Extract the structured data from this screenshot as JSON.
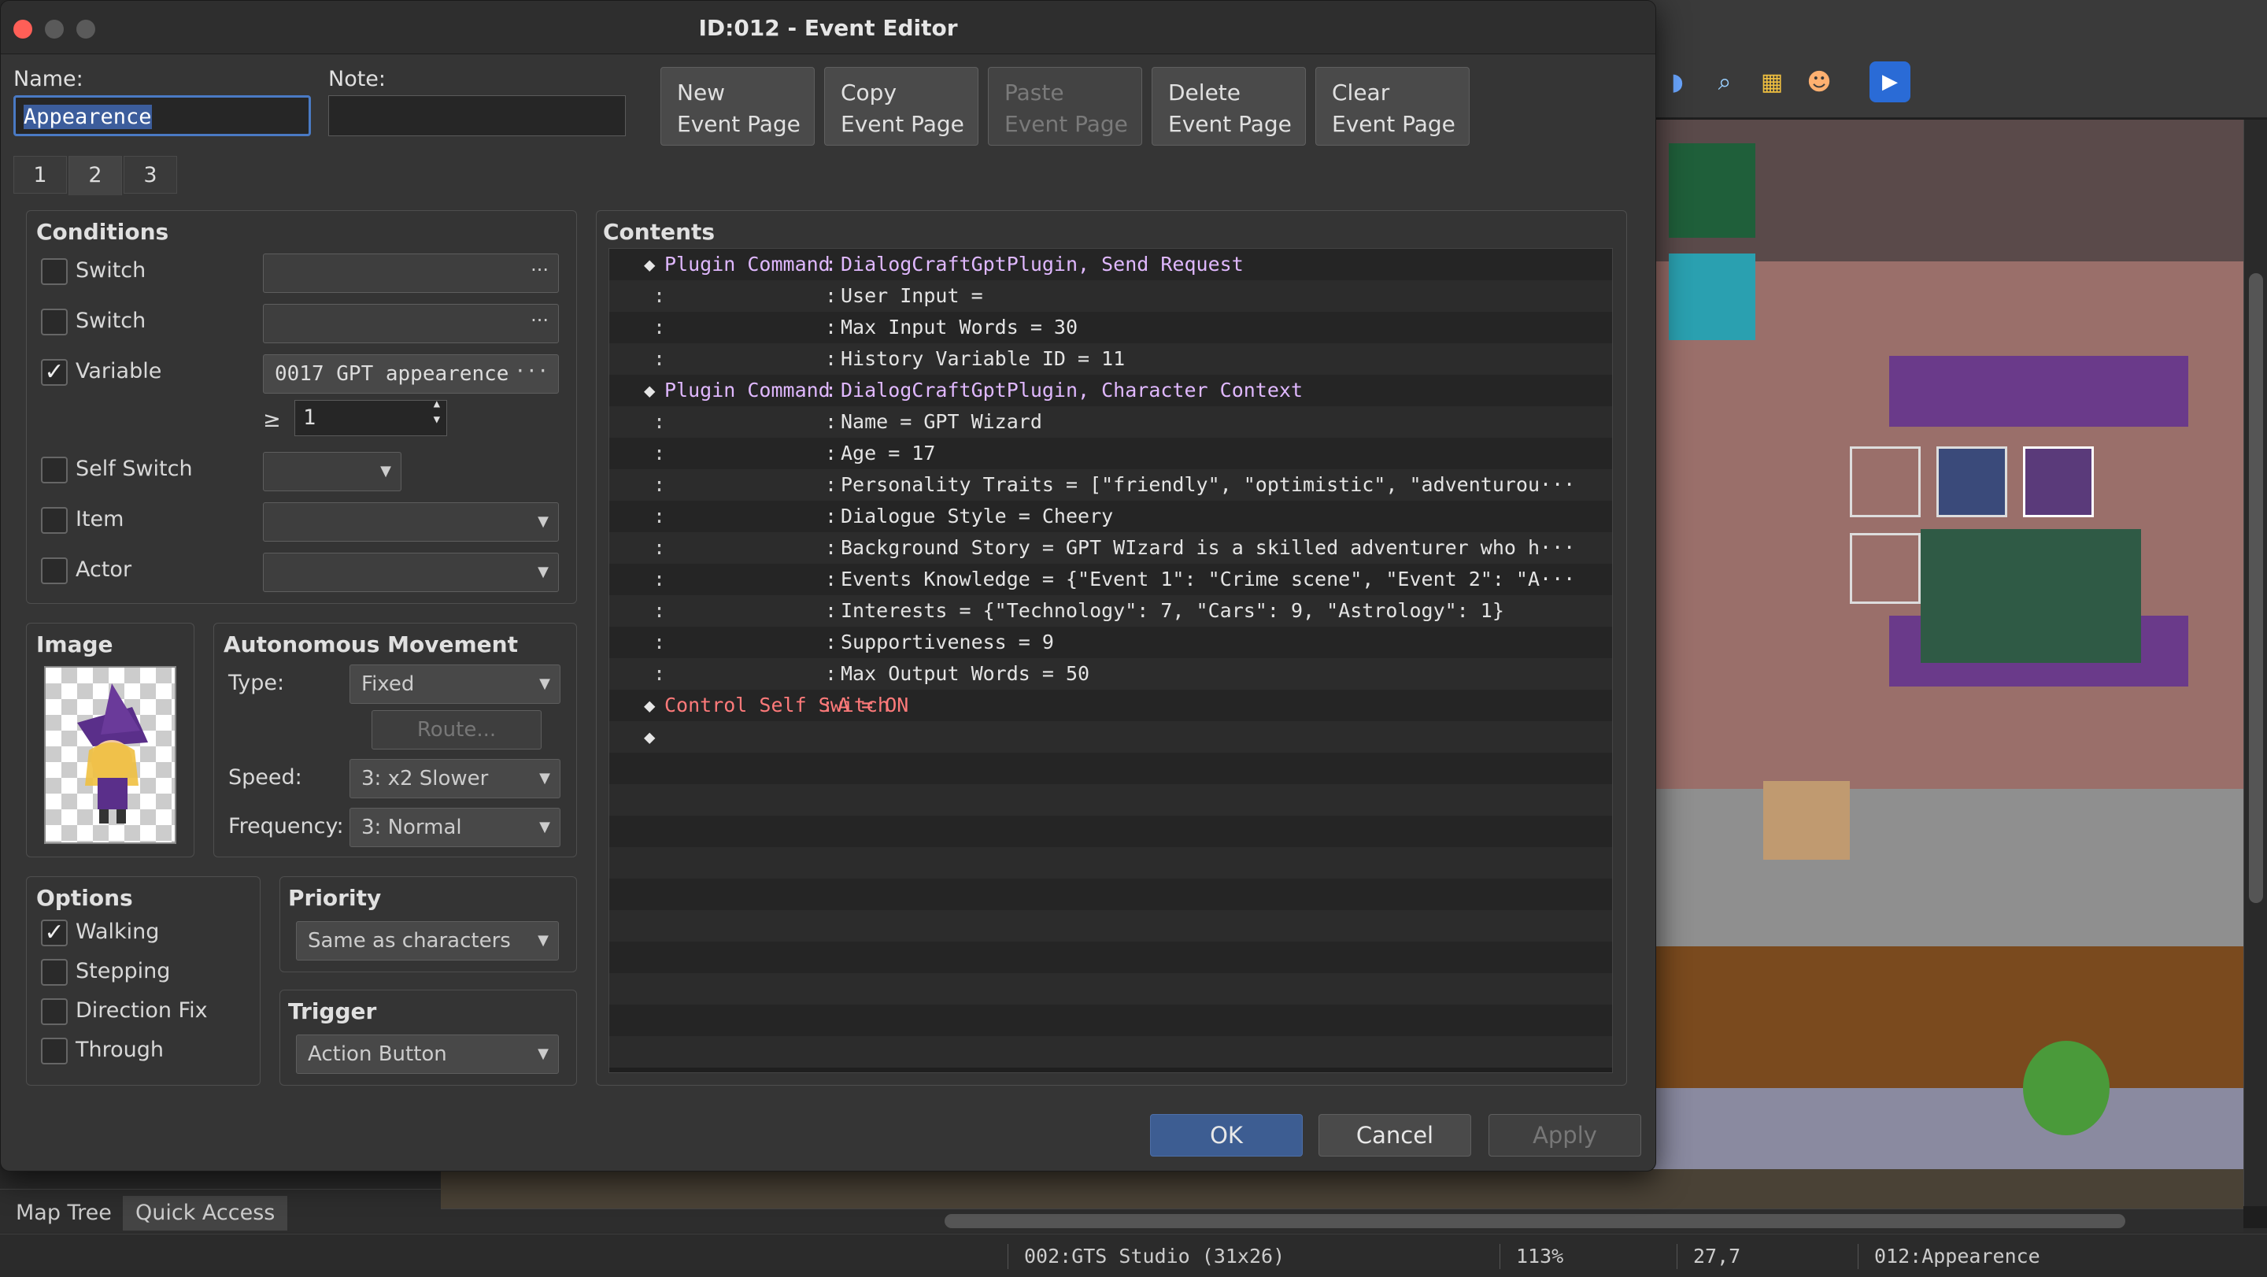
{
  "dialog": {
    "title": "ID:012 - Event Editor",
    "name_label": "Name:",
    "name_value": "Appearence",
    "note_label": "Note:",
    "note_value": "",
    "buttons": {
      "new": [
        "New",
        "Event Page"
      ],
      "copy": [
        "Copy",
        "Event Page"
      ],
      "paste": [
        "Paste",
        "Event Page"
      ],
      "delete": [
        "Delete",
        "Event Page"
      ],
      "clear": [
        "Clear",
        "Event Page"
      ]
    },
    "page_tabs": [
      "1",
      "2",
      "3"
    ],
    "active_tab": "2",
    "conditions": {
      "title": "Conditions",
      "switch1": {
        "label": "Switch",
        "checked": false,
        "value": ""
      },
      "switch2": {
        "label": "Switch",
        "checked": false,
        "value": ""
      },
      "variable": {
        "label": "Variable",
        "checked": true,
        "value": "0017 GPT appearence",
        "op": "≥",
        "amount": "1"
      },
      "self_switch": {
        "label": "Self Switch",
        "checked": false,
        "value": ""
      },
      "item": {
        "label": "Item",
        "checked": false,
        "value": ""
      },
      "actor": {
        "label": "Actor",
        "checked": false,
        "value": ""
      }
    },
    "image": {
      "title": "Image"
    },
    "movement": {
      "title": "Autonomous Movement",
      "type_label": "Type:",
      "type_value": "Fixed",
      "route_label": "Route...",
      "speed_label": "Speed:",
      "speed_value": "3: x2 Slower",
      "freq_label": "Frequency:",
      "freq_value": "3: Normal"
    },
    "options": {
      "title": "Options",
      "walking": {
        "label": "Walking",
        "checked": true
      },
      "stepping": {
        "label": "Stepping",
        "checked": false
      },
      "direction_fix": {
        "label": "Direction Fix",
        "checked": false
      },
      "through": {
        "label": "Through",
        "checked": false
      }
    },
    "priority": {
      "title": "Priority",
      "value": "Same as characters"
    },
    "trigger": {
      "title": "Trigger",
      "value": "Action Button"
    },
    "contents": {
      "title": "Contents",
      "rows": [
        {
          "kind": "cmd",
          "color": "purple",
          "name": "Plugin Command",
          "param": "DialogCraftGptPlugin, Send Request"
        },
        {
          "kind": "cont",
          "param": "User Input ="
        },
        {
          "kind": "cont",
          "param": "Max Input Words = 30"
        },
        {
          "kind": "cont",
          "param": "History Variable ID = 11"
        },
        {
          "kind": "cmd",
          "color": "purple",
          "name": "Plugin Command",
          "param": "DialogCraftGptPlugin, Character Context"
        },
        {
          "kind": "cont",
          "param": "Name = GPT Wizard"
        },
        {
          "kind": "cont",
          "param": "Age = 17"
        },
        {
          "kind": "cont",
          "param": "Personality Traits = [\"friendly\", \"optimistic\", \"adventurou···"
        },
        {
          "kind": "cont",
          "param": "Dialogue Style = Cheery"
        },
        {
          "kind": "cont",
          "param": "Background Story = GPT WIzard is a skilled adventurer who h···"
        },
        {
          "kind": "cont",
          "param": "Events Knowledge = {\"Event 1\": \"Crime scene\", \"Event 2\": \"A···"
        },
        {
          "kind": "cont",
          "param": "Interests = {\"Technology\": 7, \"Cars\": 9, \"Astrology\": 1}"
        },
        {
          "kind": "cont",
          "param": "Supportiveness = 9"
        },
        {
          "kind": "cont",
          "param": "Max Output Words = 50"
        },
        {
          "kind": "cmd",
          "color": "red",
          "name": "Control Self Switch",
          "param": "A = ON"
        },
        {
          "kind": "empty"
        }
      ]
    },
    "footer": {
      "ok": "OK",
      "cancel": "Cancel",
      "apply": "Apply"
    }
  },
  "left_tabs": {
    "map_tree": "Map Tree",
    "quick_access": "Quick Access"
  },
  "status": {
    "map": "002:GTS Studio (31x26)",
    "zoom": "113%",
    "coords": "27,7",
    "event": "012:Appearence"
  },
  "colors": {
    "accent": "#3d5d92",
    "command_purple": "#e0b8ff",
    "command_red": "#ff7a7a"
  }
}
